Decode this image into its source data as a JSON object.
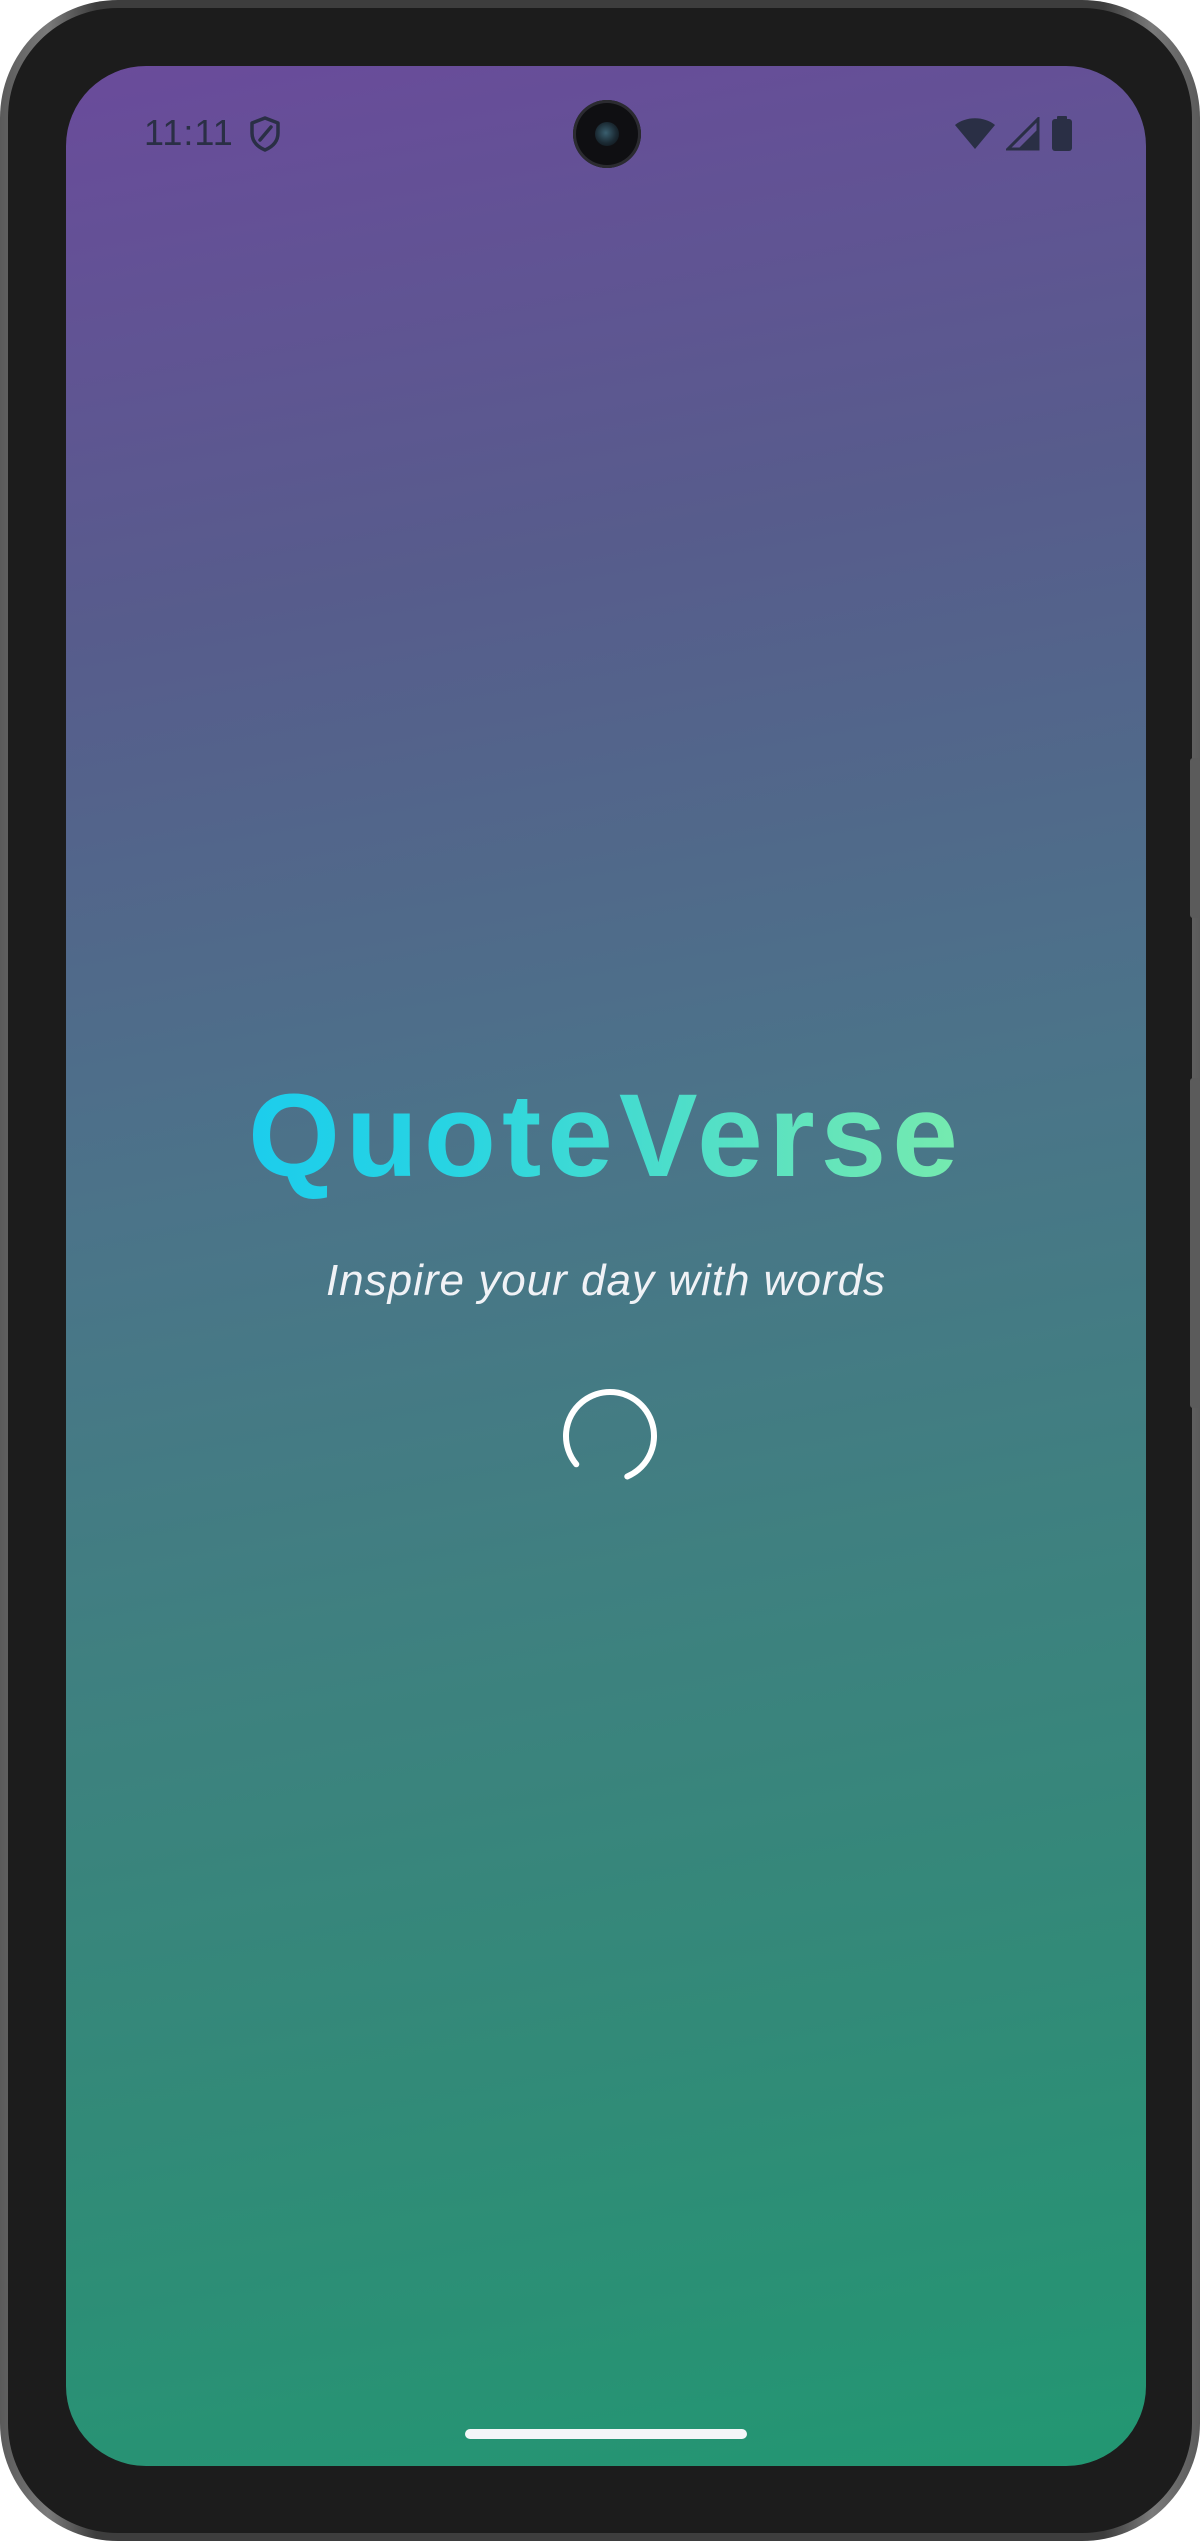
{
  "status_bar": {
    "time": "11:11",
    "icons": [
      "shield-icon",
      "wifi-icon",
      "signal-icon",
      "battery-icon"
    ]
  },
  "splash": {
    "title": "QuoteVerse",
    "tagline": "Inspire your day with words",
    "loading_indicator": "spinner-icon"
  },
  "colors": {
    "background_top": "#6a4b9b",
    "background_bottom": "#229772",
    "title_gradient_start": "#12c6f5",
    "title_gradient_end": "#8ef29e",
    "tagline": "#f0f2f6",
    "status_icons": "#2a2f45"
  }
}
